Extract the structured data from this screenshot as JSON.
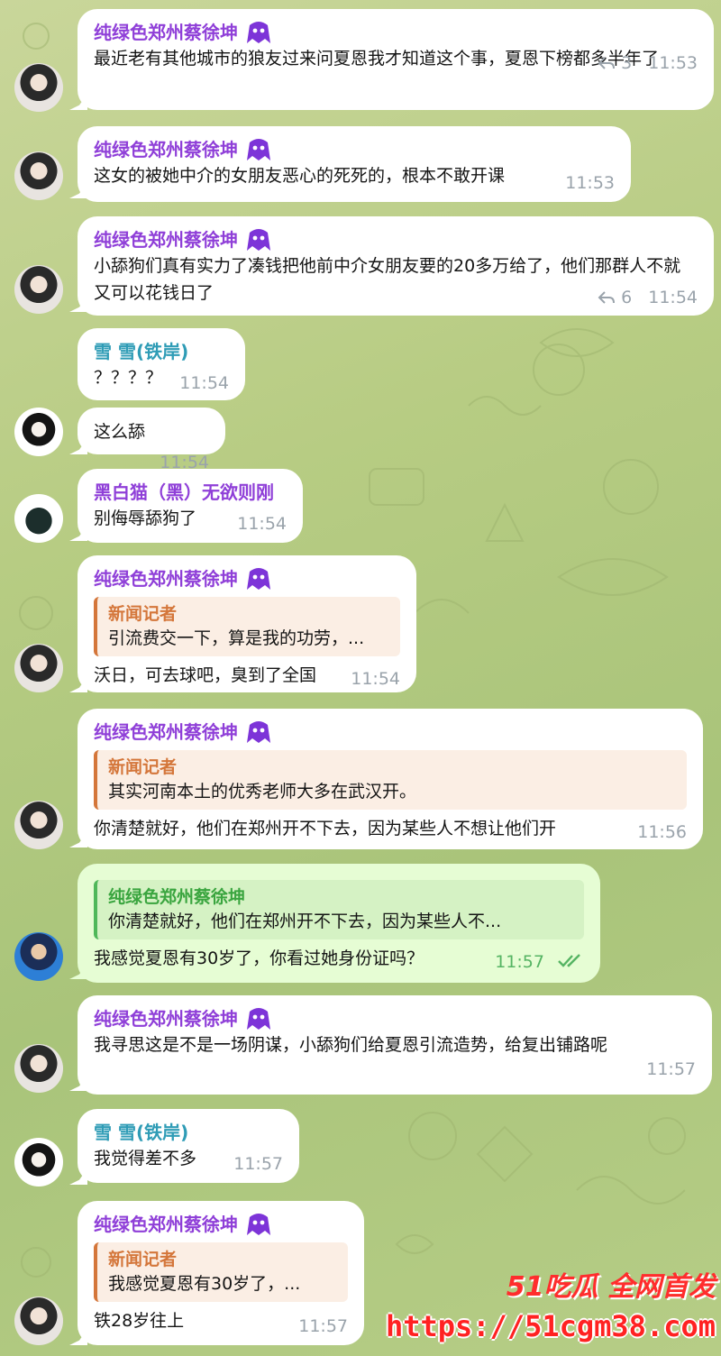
{
  "senders": {
    "cai": "纯绿色郑州蔡徐坤",
    "snow": "雪 雪(铁岸)",
    "cat": "黑白猫（黑）无欲则刚",
    "reporter": "新闻记者"
  },
  "messages": [
    {
      "id": "m1",
      "text": "最近老有其他城市的狼友过来问夏恩我才知道这个事，夏恩下榜都多半年了",
      "replies": "3",
      "time": "11:53"
    },
    {
      "id": "m2",
      "text": "这女的被她中介的女朋友恶心的死死的，根本不敢开课",
      "time": "11:53"
    },
    {
      "id": "m3",
      "text": "小舔狗们真有实力了凑钱把他前中介女朋友要的20多万给了，他们那群人不就又可以花钱日了",
      "replies": "6",
      "time": "11:54"
    },
    {
      "id": "m4",
      "text": "？？？？",
      "time": "11:54"
    },
    {
      "id": "m5",
      "text": "这么舔",
      "time": "11:54"
    },
    {
      "id": "m6",
      "text": "别侮辱舔狗了",
      "time": "11:54"
    },
    {
      "id": "m7",
      "quote": "引流费交一下，算是我的功劳，...",
      "text": "沃日，可去球吧，臭到了全国",
      "time": "11:54"
    },
    {
      "id": "m8",
      "quote": "其实河南本土的优秀老师大多在武汉开。",
      "text": "你清楚就好，他们在郑州开不下去，因为某些人不想让他们开",
      "time": "11:56"
    },
    {
      "id": "m9",
      "quote": "你清楚就好，他们在郑州开不下去，因为某些人不...",
      "text": "我感觉夏恩有30岁了，你看过她身份证吗？",
      "time": "11:57"
    },
    {
      "id": "m10",
      "text": "我寻思这是不是一场阴谋，小舔狗们给夏恩引流造势，给复出铺路呢",
      "time": "11:57"
    },
    {
      "id": "m11",
      "text": "我觉得差不多",
      "time": "11:57"
    },
    {
      "id": "m12",
      "quote": "我感觉夏恩有30岁了，...",
      "text": "铁28岁往上",
      "time": "11:57"
    }
  ],
  "watermark": {
    "top": "51吃瓜 全网首发",
    "url": "https://51cgm38.com"
  },
  "icons": {
    "reply": "reply-arrow-icon",
    "badge": "purple-ghost-badge-icon",
    "read": "double-check-icon"
  },
  "colors": {
    "background": "#b7cc83",
    "incoming_bubble": "#ffffff",
    "outgoing_bubble": "#e6fdd4",
    "sender_purple": "#8f3fd8",
    "sender_teal": "#2f9cb6",
    "quote_orange": "#d4763a",
    "quote_green": "#3aa53f",
    "watermark_red": "#ff2222"
  }
}
